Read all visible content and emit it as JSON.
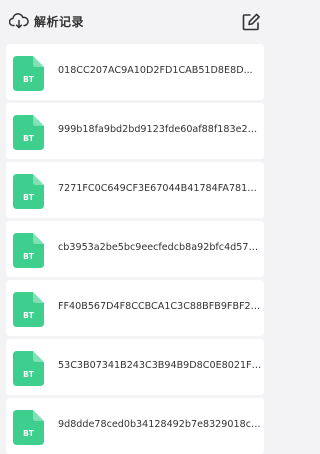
{
  "header": {
    "title": "解析记录",
    "icon": "cloud-download-icon",
    "action_icon": "edit-icon"
  },
  "colors": {
    "accent": "#3ecf8e",
    "background": "#f3f3f5",
    "text": "#333333"
  },
  "items": [
    {
      "name": "018CC207AC9A10D2FD1CAB51D8E8D...",
      "badge": "BT"
    },
    {
      "name": "999b18fa9bd2bd9123fde60af88f183e28...",
      "badge": "BT"
    },
    {
      "name": "7271FC0C649CF3E67044B41784FA78144...",
      "badge": "BT"
    },
    {
      "name": "cb3953a2be5bc9eecfedcb8a92bfc4d57dc...",
      "badge": "BT"
    },
    {
      "name": "FF40B567D4F8CCBCA1C3C88BFB9FBF2D...",
      "badge": "BT"
    },
    {
      "name": "53C3B07341B243C3B94B9D8C0E8021FD...",
      "badge": "BT"
    },
    {
      "name": "9d8dde78ced0b34128492b7e8329018c6...",
      "badge": "BT"
    }
  ]
}
